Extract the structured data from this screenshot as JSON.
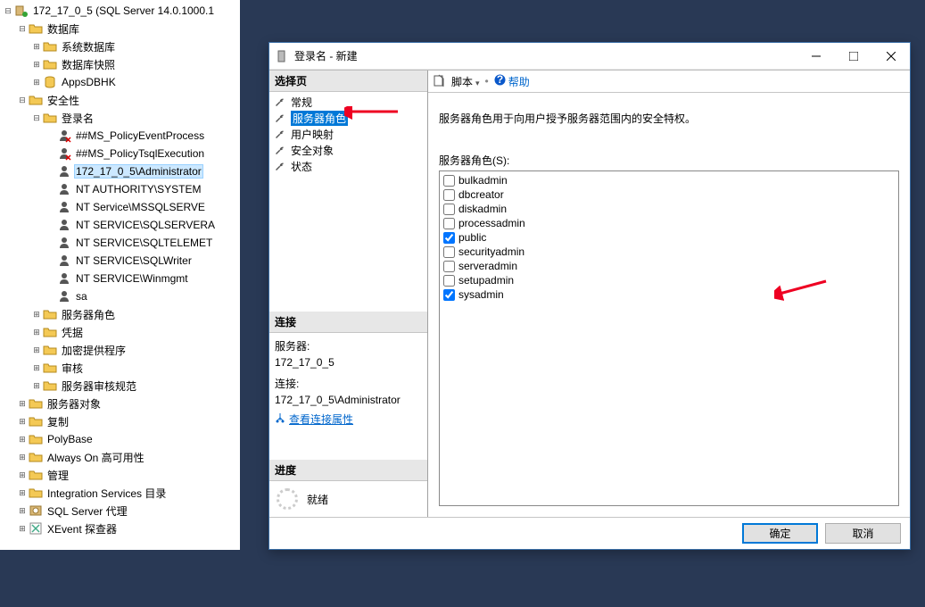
{
  "tree": {
    "server_label": "172_17_0_5 (SQL Server 14.0.1000.1",
    "databases": "数据库",
    "sys_dbs": "系统数据库",
    "db_snapshots": "数据库快照",
    "apps_db": "AppsDBHK",
    "security": "安全性",
    "logins": "登录名",
    "login_items": [
      "##MS_PolicyEventProcess",
      "##MS_PolicyTsqlExecution",
      "172_17_0_5\\Administrator",
      "NT AUTHORITY\\SYSTEM",
      "NT Service\\MSSQLSERVE",
      "NT SERVICE\\SQLSERVERA",
      "NT SERVICE\\SQLTELEMET",
      "NT SERVICE\\SQLWriter",
      "NT SERVICE\\Winmgmt",
      "sa"
    ],
    "server_roles": "服务器角色",
    "credentials": "凭据",
    "crypto_providers": "加密提供程序",
    "audits": "审核",
    "server_audit_specs": "服务器审核规范",
    "server_objects": "服务器对象",
    "replication": "复制",
    "polybase": "PolyBase",
    "always_on": "Always On 高可用性",
    "management": "管理",
    "is_catalogs": "Integration Services 目录",
    "agent": "SQL Server 代理",
    "xevent": "XEvent 探查器"
  },
  "dialog": {
    "title": "登录名 - 新建",
    "section_select_page": "选择页",
    "pages": {
      "general": "常规",
      "server_roles": "服务器角色",
      "user_mapping": "用户映射",
      "securables": "安全对象",
      "status": "状态"
    },
    "section_connection": "连接",
    "conn_server_lbl": "服务器:",
    "conn_server_val": "172_17_0_5",
    "conn_conn_lbl": "连接:",
    "conn_conn_val": "172_17_0_5\\Administrator",
    "view_conn_props": "查看连接属性",
    "section_progress": "进度",
    "progress_ready": "就绪",
    "toolbar_script": "脚本",
    "toolbar_help": "帮助",
    "desc": "服务器角色用于向用户授予服务器范围内的安全特权。",
    "roles_label": "服务器角色(S):",
    "roles": [
      {
        "name": "bulkadmin",
        "checked": false
      },
      {
        "name": "dbcreator",
        "checked": false
      },
      {
        "name": "diskadmin",
        "checked": false
      },
      {
        "name": "processadmin",
        "checked": false
      },
      {
        "name": "public",
        "checked": true
      },
      {
        "name": "securityadmin",
        "checked": false
      },
      {
        "name": "serveradmin",
        "checked": false
      },
      {
        "name": "setupadmin",
        "checked": false
      },
      {
        "name": "sysadmin",
        "checked": true
      }
    ],
    "ok": "确定",
    "cancel": "取消"
  }
}
